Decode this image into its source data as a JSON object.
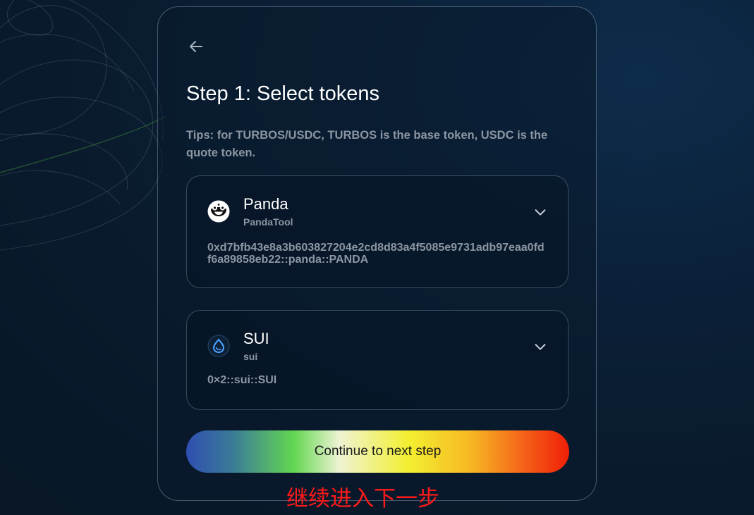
{
  "page": {
    "title": "Step 1: Select tokens",
    "tips": "Tips: for TURBOS/USDC, TURBOS is the base token, USDC is the quote token."
  },
  "tokens": [
    {
      "name": "Panda",
      "subtitle": "PandaTool",
      "address": "0xd7bfb43e8a3b603827204e2cd8d83a4f5085e9731adb97eaa0fdf6a89858eb22::panda::PANDA",
      "icon": "panda-logo-icon"
    },
    {
      "name": "SUI",
      "subtitle": "sui",
      "address": "0×2::sui::SUI",
      "icon": "sui-logo-icon"
    }
  ],
  "actions": {
    "continue_label": "Continue to next step"
  },
  "annotation": {
    "text": "继续进入下一步",
    "color": "#ff1a1a"
  },
  "colors": {
    "background": "#0a1b2e",
    "muted_text": "#8c96a3"
  }
}
